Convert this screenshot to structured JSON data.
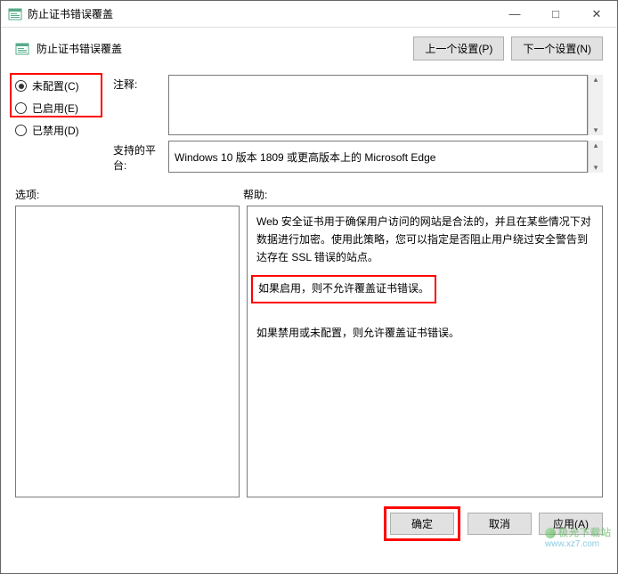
{
  "window": {
    "title": "防止证书错误覆盖",
    "minimize": "—",
    "maximize": "□",
    "close": "✕"
  },
  "toolbar": {
    "title": "防止证书错误覆盖",
    "prev_setting": "上一个设置(P)",
    "next_setting": "下一个设置(N)"
  },
  "radios": {
    "not_configured": "未配置(C)",
    "enabled": "已启用(E)",
    "disabled": "已禁用(D)"
  },
  "fields": {
    "comment_label": "注释:",
    "comment_value": "",
    "platform_label": "支持的平台:",
    "platform_value": "Windows 10 版本 1809 或更高版本上的 Microsoft Edge"
  },
  "panels": {
    "options_label": "选项:",
    "help_label": "帮助:"
  },
  "help": {
    "p1": "Web 安全证书用于确保用户访问的网站是合法的，并且在某些情况下对数据进行加密。使用此策略，您可以指定是否阻止用户绕过安全警告到达存在 SSL 错误的站点。",
    "p2": "如果启用，则不允许覆盖证书错误。",
    "p3": "如果禁用或未配置，则允许覆盖证书错误。"
  },
  "footer": {
    "ok": "确定",
    "cancel": "取消",
    "apply": "应用(A)"
  },
  "watermark": {
    "line1": "极光下载站",
    "line2": "www.xz7.com"
  }
}
